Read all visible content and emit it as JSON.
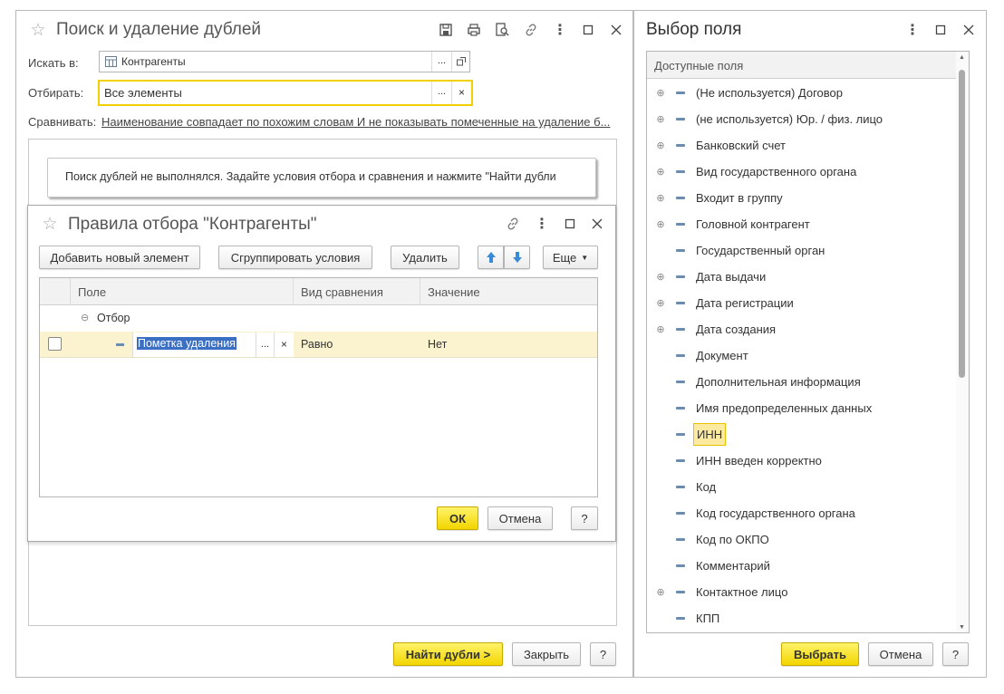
{
  "main_window": {
    "title": "Поиск и удаление дублей",
    "search_in_label": "Искать в:",
    "search_in_value": "Контрагенты",
    "filter_label": "Отбирать:",
    "filter_value": "Все элементы",
    "compare_label": "Сравнивать:",
    "compare_link": "Наименование совпадает по похожим словам И не показывать помеченные на удаление б...",
    "info_message": "Поиск дублей не выполнялся.  Задайте условия отбора и сравнения и нажмите \"Найти дубли",
    "find_button": "Найти дубли >",
    "close_button": "Закрыть",
    "help_button": "?",
    "dots": "...",
    "clear": "×"
  },
  "rules_dialog": {
    "title": "Правила отбора \"Контрагенты\"",
    "toolbar": {
      "add": "Добавить новый элемент",
      "group": "Сгруппировать условия",
      "delete": "Удалить",
      "more": "Еще"
    },
    "columns": [
      "Поле",
      "Вид сравнения",
      "Значение"
    ],
    "group_row": "Отбор",
    "row": {
      "field": "Пометка удаления",
      "comparison": "Равно",
      "value": "Нет",
      "checked": false
    },
    "ok": "ОК",
    "cancel": "Отмена",
    "help": "?"
  },
  "field_picker": {
    "title": "Выбор поля",
    "header": "Доступные поля",
    "items": [
      {
        "name": "(Не используется) Договор",
        "expandable": true
      },
      {
        "name": "(не используется) Юр. / физ. лицо",
        "expandable": true
      },
      {
        "name": "Банковский счет",
        "expandable": true
      },
      {
        "name": "Вид государственного органа",
        "expandable": true
      },
      {
        "name": "Входит в группу",
        "expandable": true
      },
      {
        "name": "Головной контрагент",
        "expandable": true
      },
      {
        "name": "Государственный орган",
        "expandable": false
      },
      {
        "name": "Дата выдачи",
        "expandable": true
      },
      {
        "name": "Дата регистрации",
        "expandable": true
      },
      {
        "name": "Дата создания",
        "expandable": true
      },
      {
        "name": "Документ",
        "expandable": false
      },
      {
        "name": "Дополнительная информация",
        "expandable": false
      },
      {
        "name": "Имя предопределенных данных",
        "expandable": false
      },
      {
        "name": "ИНН",
        "expandable": false,
        "selected": true
      },
      {
        "name": "ИНН введен корректно",
        "expandable": false
      },
      {
        "name": "Код",
        "expandable": false
      },
      {
        "name": "Код государственного органа",
        "expandable": false
      },
      {
        "name": "Код по ОКПО",
        "expandable": false
      },
      {
        "name": "Комментарий",
        "expandable": false
      },
      {
        "name": "Контактное лицо",
        "expandable": true
      },
      {
        "name": "КПП",
        "expandable": false
      }
    ],
    "select_button": "Выбрать",
    "cancel_button": "Отмена",
    "help_button": "?"
  },
  "colors": {
    "accent_yellow": "#f5d800",
    "selection_blue": "#3b6fc4",
    "row_highlight": "#fbf3cf",
    "link": "#1e5ea8"
  }
}
